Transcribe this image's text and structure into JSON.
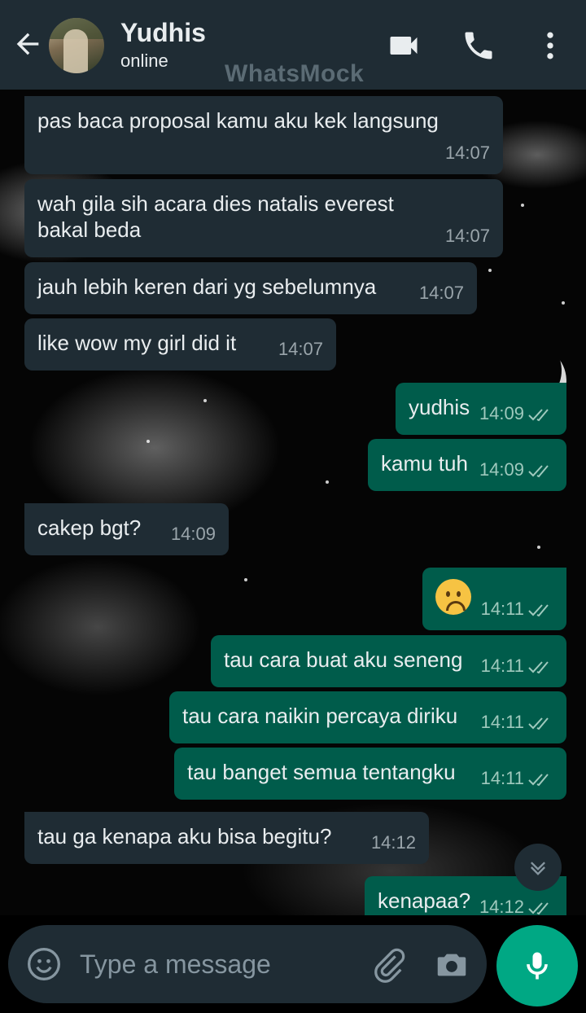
{
  "header": {
    "contact_name": "Yudhis",
    "status": "online",
    "watermark": "WhatsMock"
  },
  "messages": [
    {
      "dir": "in",
      "text": "pas baca proposal kamu aku kek langsung",
      "time": "14:07"
    },
    {
      "dir": "in",
      "text": "wah gila sih acara dies natalis everest bakal beda",
      "time": "14:07"
    },
    {
      "dir": "in",
      "text": "jauh lebih keren dari yg sebelumnya",
      "time": "14:07"
    },
    {
      "dir": "in",
      "text": "like wow my girl did it",
      "time": "14:07"
    },
    {
      "dir": "out",
      "text": "yudhis",
      "time": "14:09",
      "read": true
    },
    {
      "dir": "out",
      "text": "kamu tuh",
      "time": "14:09",
      "read": true
    },
    {
      "dir": "in",
      "text": "cakep bgt?",
      "time": "14:09"
    },
    {
      "dir": "out",
      "text": "",
      "emoji": "frowning-face",
      "time": "14:11",
      "read": true
    },
    {
      "dir": "out",
      "text": "tau cara buat aku seneng",
      "time": "14:11",
      "read": true
    },
    {
      "dir": "out",
      "text": "tau cara naikin percaya diriku",
      "time": "14:11",
      "read": true
    },
    {
      "dir": "out",
      "text": "tau banget semua tentangku",
      "time": "14:11",
      "read": true
    },
    {
      "dir": "in",
      "text": "tau ga kenapa aku bisa begitu?",
      "time": "14:12"
    },
    {
      "dir": "out",
      "text": "kenapaa?",
      "time": "14:12",
      "read": true
    }
  ],
  "composer": {
    "placeholder": "Type a message"
  },
  "icons": [
    "back-arrow-icon",
    "video-call-icon",
    "phone-icon",
    "more-vert-icon",
    "emoji-icon",
    "attach-icon",
    "camera-icon",
    "mic-icon",
    "chevron-down-icon",
    "double-check-icon"
  ],
  "colors": {
    "header_bg": "#1f2c34",
    "incoming_bubble": "#1f2c34",
    "outgoing_bubble": "#005c4b",
    "accent": "#00a884"
  }
}
